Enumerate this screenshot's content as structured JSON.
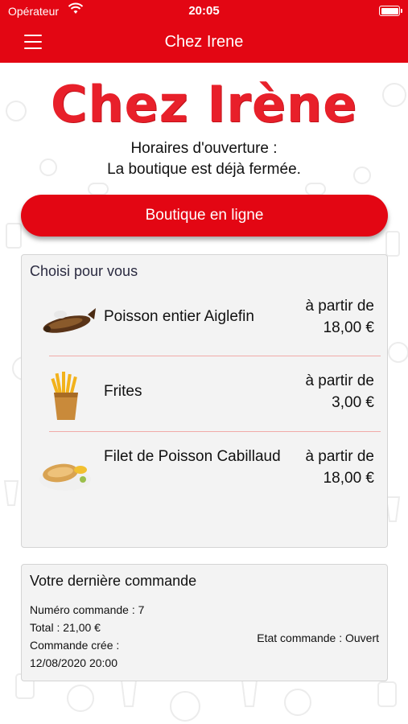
{
  "status_bar": {
    "carrier": "Opérateur",
    "time": "20:05"
  },
  "nav": {
    "title": "Chez Irene",
    "menu_icon": "hamburger-menu-icon"
  },
  "logo_text": "Chez Irène",
  "hours": {
    "heading": "Horaires d'ouverture :",
    "status": "La boutique est déjà fermée."
  },
  "shop_button": "Boutique en ligne",
  "picks": {
    "title": "Choisi pour vous",
    "items": [
      {
        "name": "Poisson entier Aiglefin",
        "from": "à partir de",
        "price": "18,00 €",
        "icon": "fried-fish-icon"
      },
      {
        "name": "Frites",
        "from": "à partir de",
        "price": "3,00 €",
        "icon": "fries-icon"
      },
      {
        "name": "Filet de Poisson Cabillaud",
        "from": "à partir de",
        "price": "18,00 €",
        "icon": "fish-fillet-icon"
      }
    ]
  },
  "last_order": {
    "title": "Votre dernière commande",
    "number": "Numéro commande : 7",
    "total": "Total : 21,00 €",
    "created_label": "Commande crée :",
    "created_date": "12/08/2020 20:00",
    "status": "Etat commande : Ouvert"
  },
  "colors": {
    "brand_red": "#e30613",
    "logo_red": "#e8202a",
    "divider": "#f0aaa8"
  }
}
